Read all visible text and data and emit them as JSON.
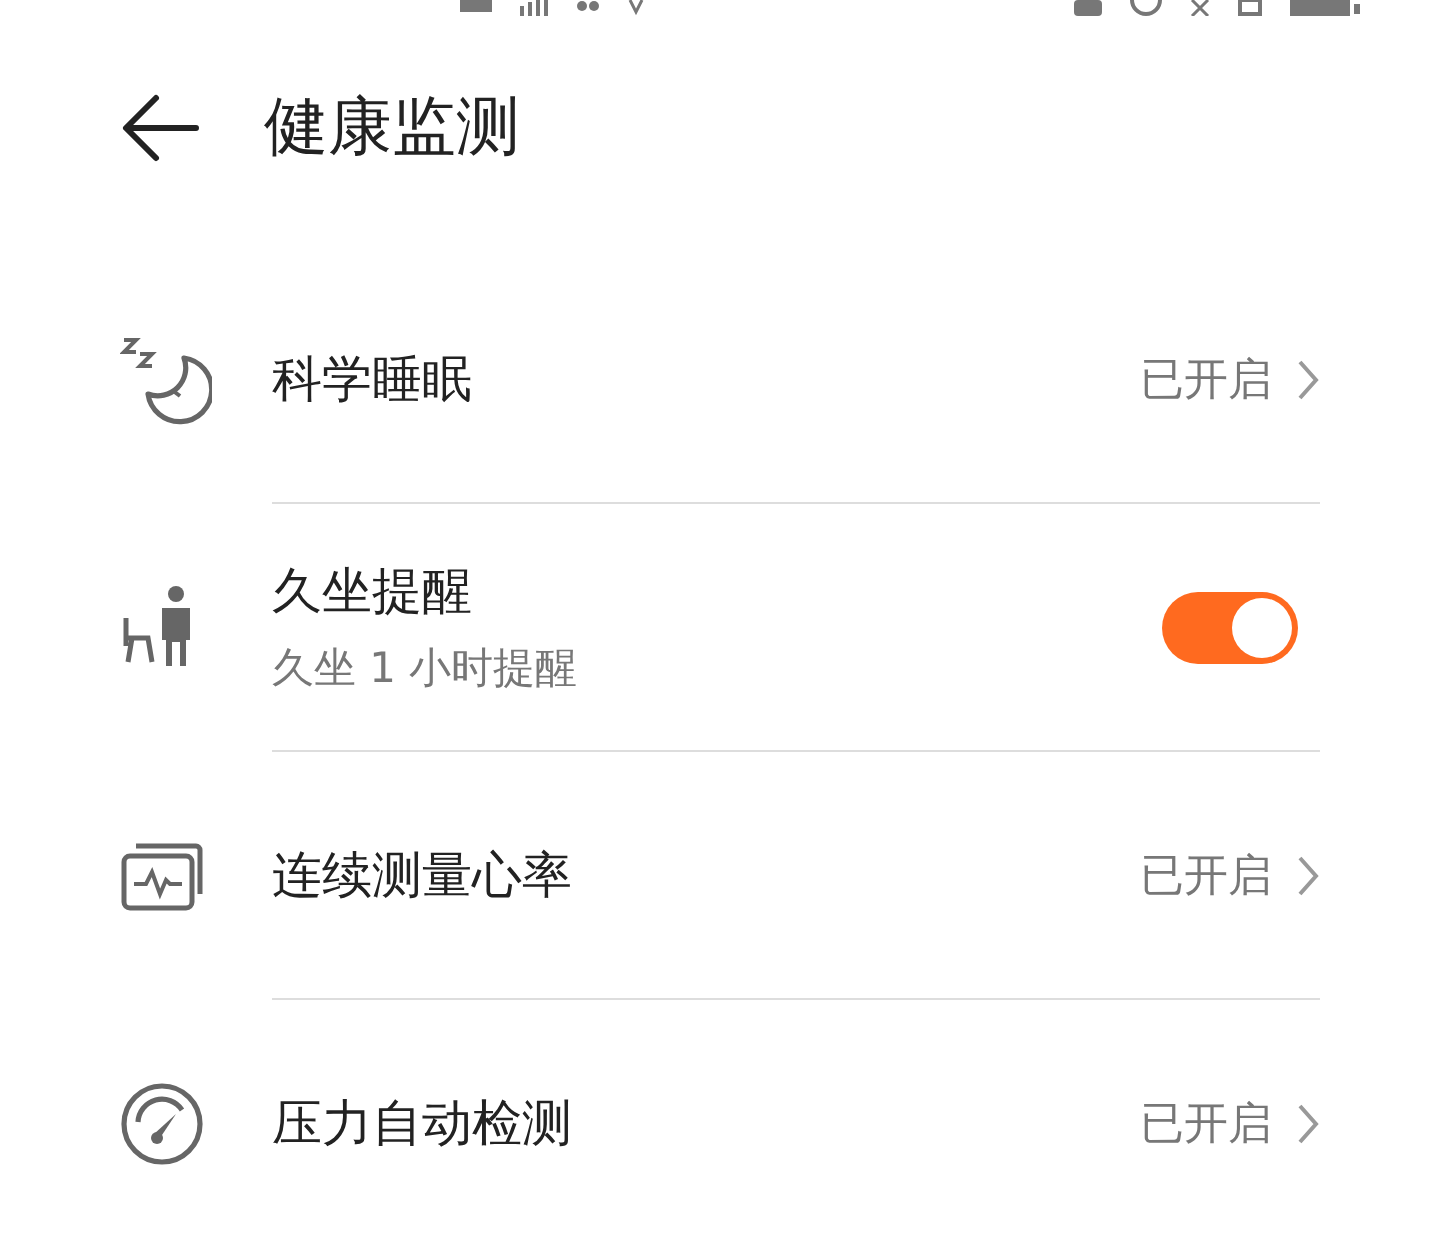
{
  "header": {
    "title": "健康监测"
  },
  "items": [
    {
      "kind": "link",
      "label": "科学睡眠",
      "status": "已开启"
    },
    {
      "kind": "toggle",
      "label": "久坐提醒",
      "subtitle": "久坐 1 小时提醒",
      "on": true
    },
    {
      "kind": "link",
      "label": "连续测量心率",
      "status": "已开启"
    },
    {
      "kind": "link",
      "label": "压力自动检测",
      "status": "已开启"
    }
  ]
}
